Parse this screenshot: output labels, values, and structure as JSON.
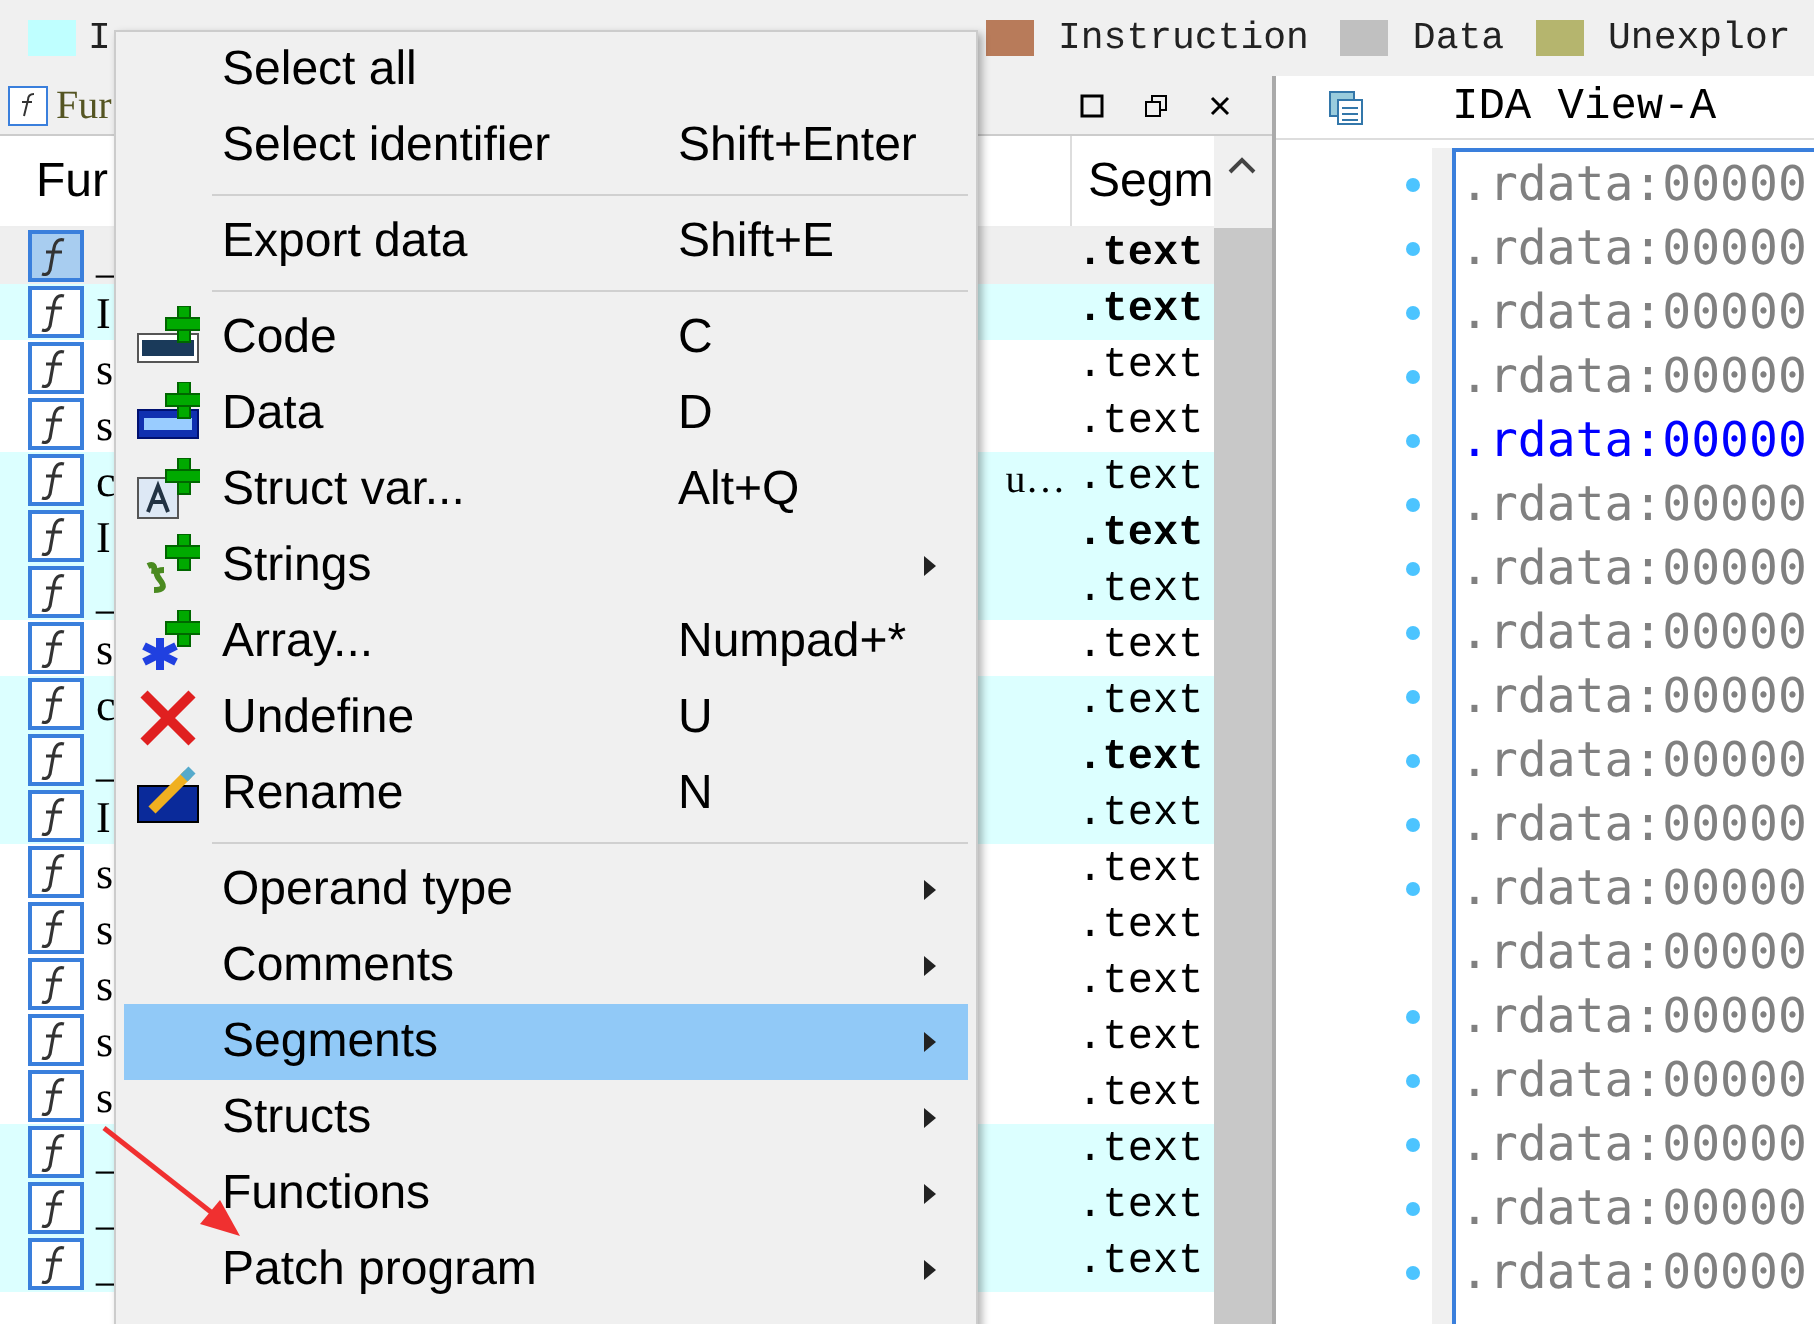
{
  "legend": [
    {
      "label": "I",
      "color": "#bfffff"
    },
    {
      "label": "Instruction",
      "color": "#b87b5a"
    },
    {
      "label": "Data",
      "color": "#c0c0c0"
    },
    {
      "label": "Unexplor",
      "color": "#b5b56e"
    }
  ],
  "functions_panel": {
    "title": "Fur",
    "columns": [
      "Fur",
      "Segm"
    ],
    "rows": [
      {
        "name": "_",
        "segment": ".text",
        "bold": true,
        "highlighted": false,
        "selected": true
      },
      {
        "name": "I",
        "segment": ".text",
        "bold": true,
        "highlighted": true,
        "selected": false
      },
      {
        "name": "s",
        "segment": ".text",
        "bold": false,
        "highlighted": false,
        "selected": false
      },
      {
        "name": "s",
        "segment": ".text",
        "bold": false,
        "highlighted": false,
        "selected": false
      },
      {
        "name": "c",
        "name_end": "u…",
        "segment": ".text",
        "bold": false,
        "highlighted": true,
        "selected": false
      },
      {
        "name": "I",
        "segment": ".text",
        "bold": true,
        "highlighted": true,
        "selected": false
      },
      {
        "name": "_",
        "segment": ".text",
        "bold": false,
        "highlighted": true,
        "selected": false
      },
      {
        "name": "s",
        "segment": ".text",
        "bold": false,
        "highlighted": false,
        "selected": false
      },
      {
        "name": "c",
        "segment": ".text",
        "bold": false,
        "highlighted": true,
        "selected": false
      },
      {
        "name": "_",
        "segment": ".text",
        "bold": true,
        "highlighted": true,
        "selected": false
      },
      {
        "name": "I",
        "segment": ".text",
        "bold": false,
        "highlighted": true,
        "selected": false
      },
      {
        "name": "s",
        "segment": ".text",
        "bold": false,
        "highlighted": false,
        "selected": false
      },
      {
        "name": "s",
        "segment": ".text",
        "bold": false,
        "highlighted": false,
        "selected": false
      },
      {
        "name": "s",
        "segment": ".text",
        "bold": false,
        "highlighted": false,
        "selected": false
      },
      {
        "name": "s",
        "segment": ".text",
        "bold": false,
        "highlighted": false,
        "selected": false
      },
      {
        "name": "s",
        "segment": ".text",
        "bold": false,
        "highlighted": false,
        "selected": false
      },
      {
        "name": "_",
        "segment": ".text",
        "bold": false,
        "highlighted": true,
        "selected": false
      },
      {
        "name": "_",
        "segment": ".text",
        "bold": false,
        "highlighted": true,
        "selected": false
      },
      {
        "name": "_",
        "segment": ".text",
        "bold": false,
        "highlighted": true,
        "selected": false
      }
    ]
  },
  "ida_view": {
    "title": "IDA View-A",
    "lines": [
      {
        "text": ".rdata:00000",
        "dot": true,
        "highlighted": false
      },
      {
        "text": ".rdata:00000",
        "dot": true,
        "highlighted": false
      },
      {
        "text": ".rdata:00000",
        "dot": true,
        "highlighted": false
      },
      {
        "text": ".rdata:00000",
        "dot": true,
        "highlighted": false
      },
      {
        "text": ".rdata:00000",
        "dot": true,
        "highlighted": true
      },
      {
        "text": ".rdata:00000",
        "dot": true,
        "highlighted": false
      },
      {
        "text": ".rdata:00000",
        "dot": true,
        "highlighted": false
      },
      {
        "text": ".rdata:00000",
        "dot": true,
        "highlighted": false
      },
      {
        "text": ".rdata:00000",
        "dot": true,
        "highlighted": false
      },
      {
        "text": ".rdata:00000",
        "dot": true,
        "highlighted": false
      },
      {
        "text": ".rdata:00000",
        "dot": true,
        "highlighted": false
      },
      {
        "text": ".rdata:00000",
        "dot": true,
        "highlighted": false
      },
      {
        "text": ".rdata:00000",
        "dot": false,
        "highlighted": false
      },
      {
        "text": ".rdata:00000",
        "dot": true,
        "highlighted": false
      },
      {
        "text": ".rdata:00000",
        "dot": true,
        "highlighted": false
      },
      {
        "text": ".rdata:00000",
        "dot": true,
        "highlighted": false
      },
      {
        "text": ".rdata:00000",
        "dot": true,
        "highlighted": false
      },
      {
        "text": ".rdata:00000",
        "dot": true,
        "highlighted": false
      }
    ]
  },
  "context_menu": {
    "items": [
      {
        "kind": "item",
        "label": "Select all",
        "submenu": false,
        "selected": false
      },
      {
        "kind": "item",
        "label": "Select identifier",
        "shortcut": "Shift+Enter",
        "submenu": false,
        "selected": false
      },
      {
        "kind": "separator"
      },
      {
        "kind": "item",
        "label": "Export data",
        "shortcut": "Shift+E",
        "submenu": false,
        "selected": false
      },
      {
        "kind": "separator"
      },
      {
        "kind": "item",
        "label": "Code",
        "shortcut": "C",
        "submenu": false,
        "selected": false
      },
      {
        "kind": "item",
        "label": "Data",
        "shortcut": "D",
        "submenu": false,
        "selected": false
      },
      {
        "kind": "item",
        "label": "Struct var...",
        "shortcut": "Alt+Q",
        "submenu": false,
        "selected": false
      },
      {
        "kind": "item",
        "label": "Strings",
        "submenu": true,
        "selected": false
      },
      {
        "kind": "item",
        "label": "Array...",
        "shortcut": "Numpad+*",
        "submenu": false,
        "selected": false
      },
      {
        "kind": "item",
        "label": "Undefine",
        "shortcut": "U",
        "submenu": false,
        "selected": false
      },
      {
        "kind": "item",
        "label": "Rename",
        "shortcut": "N",
        "submenu": false,
        "selected": false
      },
      {
        "kind": "separator"
      },
      {
        "kind": "item",
        "label": "Operand type",
        "submenu": true,
        "selected": false
      },
      {
        "kind": "item",
        "label": "Comments",
        "submenu": true,
        "selected": false
      },
      {
        "kind": "item",
        "label": "Segments",
        "submenu": true,
        "selected": true
      },
      {
        "kind": "item",
        "label": "Structs",
        "submenu": true,
        "selected": false
      },
      {
        "kind": "item",
        "label": "Functions",
        "submenu": true,
        "selected": false
      },
      {
        "kind": "item",
        "label": "Patch program",
        "submenu": true,
        "selected": false
      }
    ]
  }
}
